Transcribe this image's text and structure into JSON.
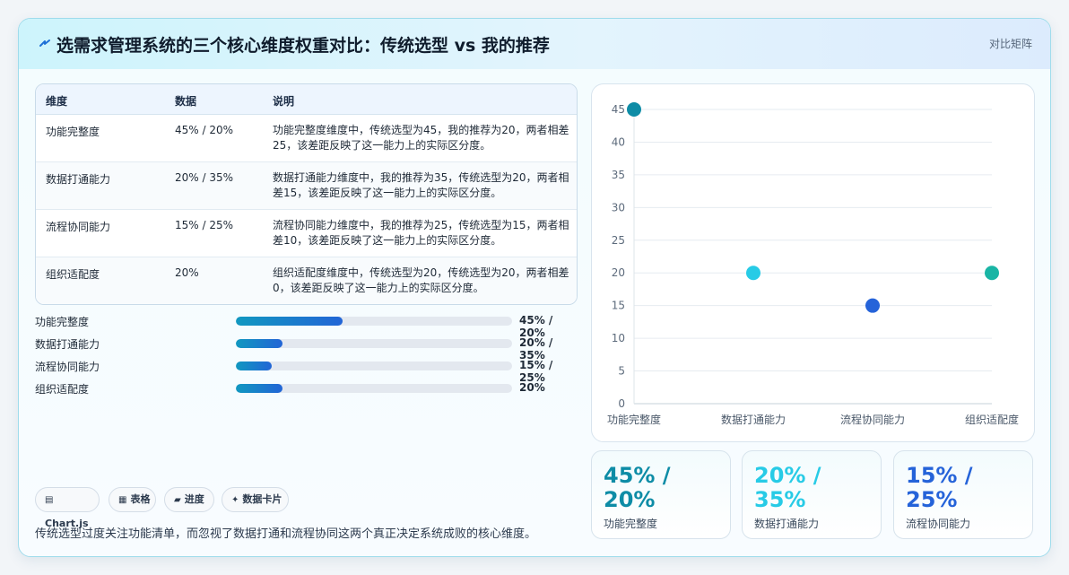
{
  "header": {
    "title": "选需求管理系统的三个核心维度权重对比：传统选型 vs 我的推荐",
    "label": "对比矩阵"
  },
  "table": {
    "headers": [
      "维度",
      "数据",
      "说明"
    ],
    "rows": [
      {
        "dimension": "功能完整度",
        "data": "45% / 20%",
        "desc": "功能完整度维度中，传统选型为45，我的推荐为20，两者相差25，该差距反映了这一能力上的实际区分度。"
      },
      {
        "dimension": "数据打通能力",
        "data": "20% / 35%",
        "desc": "数据打通能力维度中，我的推荐为35，传统选型为20，两者相差15，该差距反映了这一能力上的实际区分度。"
      },
      {
        "dimension": "流程协同能力",
        "data": "15% / 25%",
        "desc": "流程协同能力维度中，我的推荐为25，传统选型为15，两者相差10，该差距反映了这一能力上的实际区分度。"
      },
      {
        "dimension": "组织适配度",
        "data": "20%",
        "desc": "组织适配度维度中，传统选型为20，传统选型为20，两者相差0，该差距反映了这一能力上的实际区分度。"
      }
    ]
  },
  "progress": [
    {
      "label": "功能完整度",
      "value": "45% / 20%",
      "fraction": 0.385
    },
    {
      "label": "数据打通能力",
      "value": "20% / 35%",
      "fraction": 0.17
    },
    {
      "label": "流程协同能力",
      "value": "15% / 25%",
      "fraction": 0.13
    },
    {
      "label": "组织适配度",
      "value": "20%",
      "fraction": 0.17
    }
  ],
  "chips": [
    {
      "icon": "chart-icon",
      "glyph": "▤",
      "label": "Chart.js"
    },
    {
      "icon": "table-icon",
      "glyph": "▦",
      "label": "表格"
    },
    {
      "icon": "folder-icon",
      "glyph": "▰",
      "label": "进度"
    },
    {
      "icon": "sparkle-icon",
      "glyph": "✦",
      "label": "数据卡片"
    }
  ],
  "footer": "传统选型过度关注功能清单，而忽视了数据打通和流程协同这两个真正决定系统成败的核心维度。",
  "stats": [
    {
      "value": "45% / 20%",
      "label": "功能完整度",
      "color": "#0e8ca6"
    },
    {
      "value": "20% / 35%",
      "label": "数据打通能力",
      "color": "#27cbe6"
    },
    {
      "value": "15% / 25%",
      "label": "流程协同能力",
      "color": "#2563d9"
    }
  ],
  "chart_data": {
    "type": "scatter",
    "categories": [
      "功能完整度",
      "数据打通能力",
      "流程协同能力",
      "组织适配度"
    ],
    "values": [
      45,
      20,
      15,
      20
    ],
    "colors": [
      "#0e8ca6",
      "#27cbe6",
      "#2563d9",
      "#19b5a5"
    ],
    "ylim": [
      0,
      45
    ],
    "yticks": [
      0,
      5,
      10,
      15,
      20,
      25,
      30,
      35,
      40,
      45
    ],
    "grid": true,
    "title": "",
    "xlabel": "",
    "ylabel": ""
  }
}
